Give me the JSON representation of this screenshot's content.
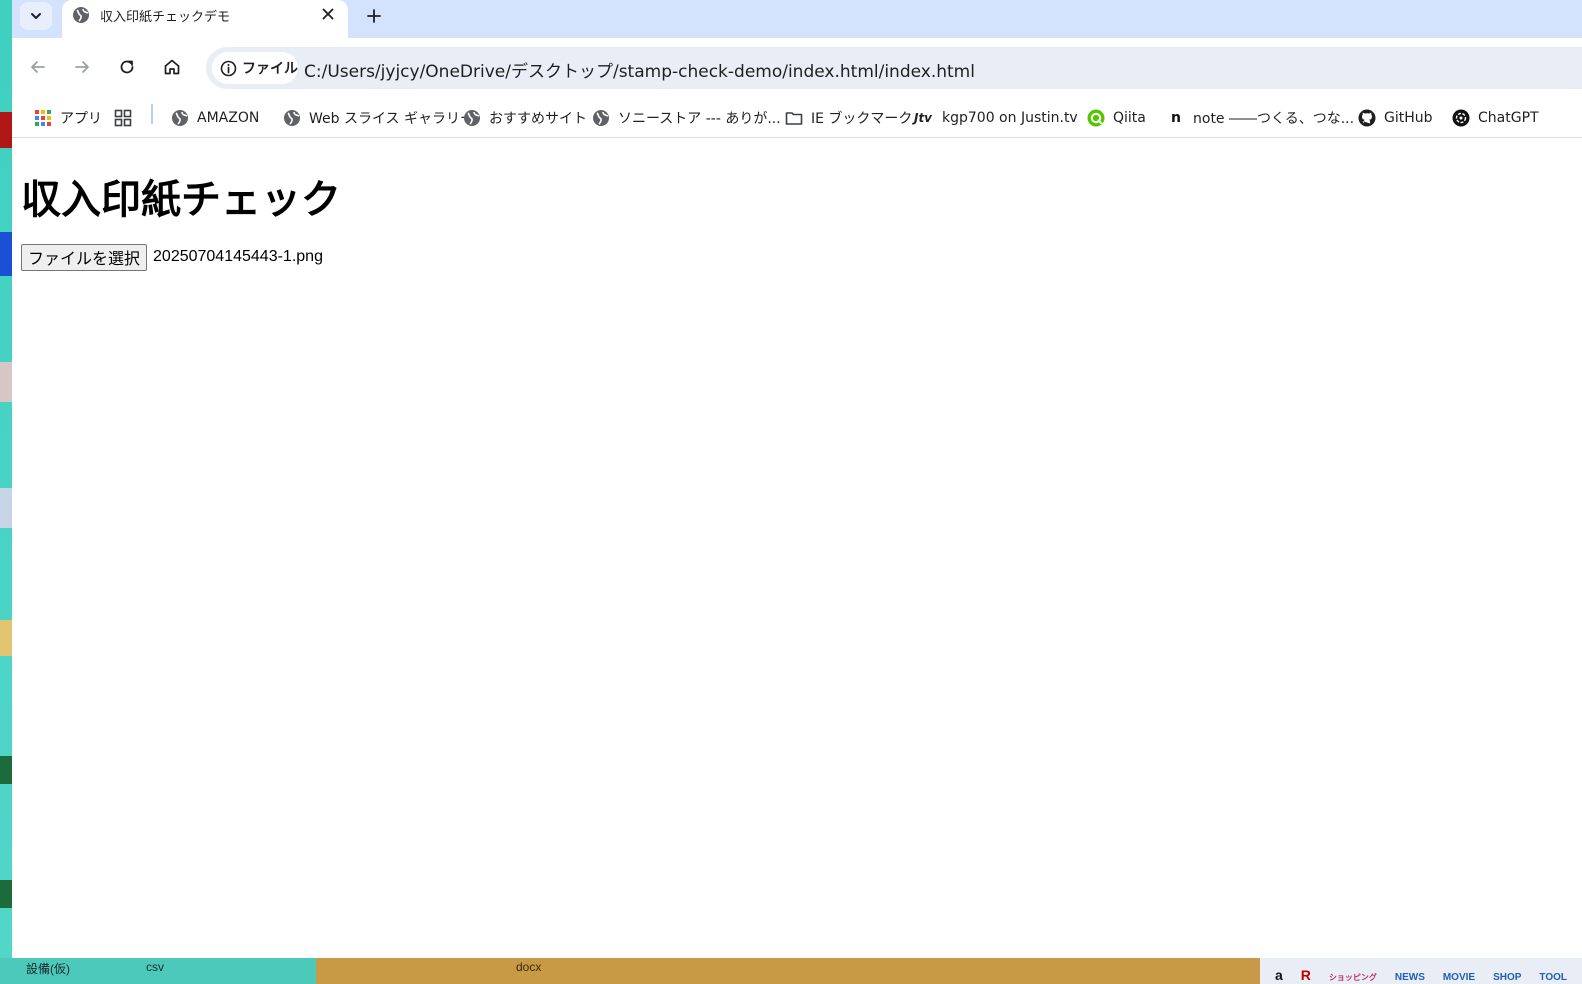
{
  "browser": {
    "tab": {
      "title": "収入印紙チェックデモ"
    },
    "address": {
      "chip_label": "ファイル",
      "url": "C:/Users/jyjcy/OneDrive/デスクトップ/stamp-check-demo/index.html/index.html"
    },
    "bookmarks": [
      {
        "label": "アプリ",
        "icon": "apps-grid-icon"
      },
      {
        "label": "",
        "icon": "tab-groups-icon"
      },
      {
        "label": "AMAZON",
        "icon": "globe-icon"
      },
      {
        "label": "Web スライス ギャラリー",
        "icon": "globe-icon"
      },
      {
        "label": "おすすめサイト",
        "icon": "globe-icon"
      },
      {
        "label": "ソニーストア --- ありが...",
        "icon": "globe-icon"
      },
      {
        "label": "IE ブックマーク",
        "icon": "folder-icon"
      },
      {
        "label": "kgp700 on Justin.tv",
        "icon": "jtv-icon"
      },
      {
        "label": "Qiita",
        "icon": "qiita-icon"
      },
      {
        "label": "note ――つくる、つな...",
        "icon": "note-icon"
      },
      {
        "label": "GitHub",
        "icon": "github-icon"
      },
      {
        "label": "ChatGPT",
        "icon": "chatgpt-icon"
      }
    ]
  },
  "page": {
    "title": "収入印紙チェック",
    "file_button": "ファイルを選択",
    "file_name": "20250704145443-1.png"
  },
  "desktop": {
    "taskbar_texts": [
      "設備(仮)",
      "csv",
      "docx"
    ],
    "tray_labels": [
      "a",
      "R",
      "ショッピング",
      "NEWS",
      "MOVIE",
      "SHOP",
      "TOOL"
    ]
  },
  "colors": {
    "tabstrip": "#d3e3fd",
    "omnibox": "#e9eef6",
    "desktop": "#5ad1c6"
  }
}
